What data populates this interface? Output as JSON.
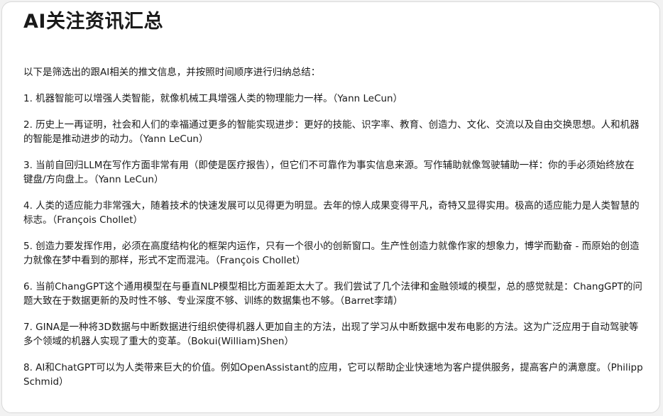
{
  "title": "AI关注资讯汇总",
  "intro": "以下是筛选出的跟AI相关的推文信息，并按照时间顺序进行归纳总结：",
  "items": [
    {
      "text": "1. 机器智能可以增强人类智能，就像机械工具增强人类的物理能力一样。（Yann LeCun）"
    },
    {
      "text": "2. 历史上一再证明，社会和人们的幸福通过更多的智能实现进步：更好的技能、识字率、教育、创造力、文化、交流以及自由交换思想。人和机器的智能是推动进步的动力。（Yann LeCun）"
    },
    {
      "text": "3. 当前自回归LLM在写作方面非常有用（即使是医疗报告），但它们不可靠作为事实信息来源。写作辅助就像驾驶辅助一样：你的手必须始终放在键盘/方向盘上。（Yann LeCun）"
    },
    {
      "text": "4. 人类的适应能力非常强大，随着技术的快速发展可以见得更为明显。去年的惊人成果变得平凡，奇特又显得实用。极高的适应能力是人类智慧的标志。（François Chollet）"
    },
    {
      "text": "5. 创造力要发挥作用，必须在高度结构化的框架内运作，只有一个很小的创新窗口。生产性创造力就像作家的想象力，博学而勤奋 - 而原始的创造力就像在梦中看到的那样，形式不定而混沌。（François Chollet）"
    },
    {
      "text": "6. 当前ChangGPT这个通用模型在与垂直NLP模型相比方面差距太大了。我们尝试了几个法律和金融领域的模型，总的感觉就是：ChangGPT的问题大致在于数据更新的及时性不够、专业深度不够、训练的数据集也不够。（Barret李靖）"
    },
    {
      "text": "7. GINA是一种将3D数据与中断数据进行组织使得机器人更加自主的方法，出现了学习从中断数据中发布电影的方法。这为广泛应用于自动驾驶等多个领域的机器人实现了重大的变革。（Bokui(William)Shen）"
    },
    {
      "text": "8. AI和ChatGPT可以为人类带来巨大的价值。例如OpenAssistant的应用，它可以帮助企业快速地为客户提供服务，提高客户的满意度。（Philipp Schmid）"
    }
  ]
}
